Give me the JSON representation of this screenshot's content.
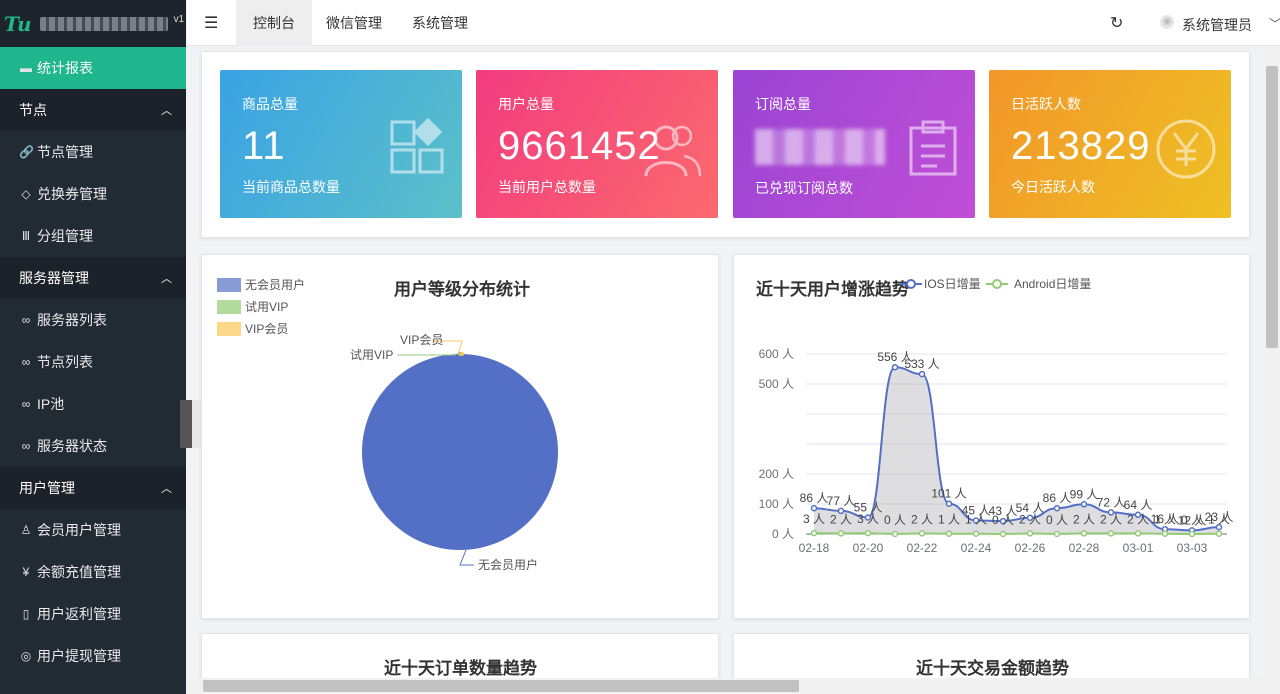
{
  "brand": {
    "logo": "Tu",
    "version": "v1"
  },
  "sidebar": {
    "active_item": {
      "icon": "▬",
      "label": "统计报表"
    },
    "groups": [
      {
        "label": "节点",
        "items": [
          {
            "icon": "🔗",
            "label": "节点管理"
          },
          {
            "icon": "◇",
            "label": "兑换券管理"
          },
          {
            "icon": "Ⅲ",
            "label": "分组管理"
          }
        ]
      },
      {
        "label": "服务器管理",
        "items": [
          {
            "icon": "∞",
            "label": "服务器列表"
          },
          {
            "icon": "∞",
            "label": "节点列表"
          },
          {
            "icon": "∞",
            "label": "IP池"
          },
          {
            "icon": "∞",
            "label": "服务器状态"
          }
        ]
      },
      {
        "label": "用户管理",
        "items": [
          {
            "icon": "♙",
            "label": "会员用户管理"
          },
          {
            "icon": "¥",
            "label": "余额充值管理"
          },
          {
            "icon": "▯",
            "label": "用户返利管理"
          },
          {
            "icon": "◎",
            "label": "用户提现管理"
          }
        ]
      }
    ]
  },
  "topbar": {
    "tabs": [
      "控制台",
      "微信管理",
      "系统管理"
    ],
    "user_name": "系统管理员"
  },
  "stats": [
    {
      "title": "商品总量",
      "value": "11",
      "sub": "当前商品总数量",
      "icon": "grid-icon",
      "color_from": "#3aa3e3",
      "color_to": "#5cc0c9"
    },
    {
      "title": "用户总量",
      "value": "9661452",
      "sub": "当前用户总数量",
      "icon": "users-icon",
      "color_from": "#f23c7f",
      "color_to": "#fb6a6e"
    },
    {
      "title": "订阅总量",
      "value": "",
      "sub": "已兑现订阅总数",
      "icon": "clipboard-icon",
      "color_from": "#9a44d3",
      "color_to": "#c04fd6"
    },
    {
      "title": "日活跃人数",
      "value": "213829",
      "sub": "今日活跃人数",
      "icon": "yen-icon",
      "color_from": "#f2962a",
      "color_to": "#eec124"
    }
  ],
  "pie_panel": {
    "title": "用户等级分布统计",
    "legend": [
      {
        "label": "无会员用户",
        "color": "#5470c6"
      },
      {
        "label": "试用VIP",
        "color": "#91cc75"
      },
      {
        "label": "VIP会员",
        "color": "#fac858"
      }
    ],
    "callouts": {
      "vip": "VIP会员",
      "trial": "试用VIP",
      "free": "无会员用户"
    }
  },
  "line_panel": {
    "title": "近十天用户增涨趋势",
    "legend": [
      {
        "label": "IOS日增量",
        "color": "#5470c6"
      },
      {
        "label": "Android日增量",
        "color": "#91cc75"
      }
    ]
  },
  "bottom_panels": {
    "left_title": "近十天订单数量趋势",
    "right_title": "近十天交易金额趋势"
  },
  "chart_data": [
    {
      "type": "pie",
      "title": "用户等级分布统计",
      "labels": [
        "无会员用户",
        "试用VIP",
        "VIP会员"
      ],
      "values": [
        99.9,
        0.05,
        0.05
      ],
      "legend": "top-left"
    },
    {
      "type": "line",
      "title": "近十天用户增涨趋势",
      "x": [
        "02-18",
        "02-19",
        "02-20",
        "02-21",
        "02-22",
        "02-23",
        "02-24",
        "02-25",
        "02-26",
        "02-27",
        "02-28",
        "02-29",
        "03-01",
        "03-02",
        "03-03",
        "03-04"
      ],
      "x_tick_labels": [
        "02-18",
        "02-20",
        "02-22",
        "02-24",
        "02-26",
        "02-28",
        "03-01",
        "03-03"
      ],
      "y_tick_labels": [
        "0 人",
        "100 人",
        "200 人",
        "500 人",
        "600 人"
      ],
      "series": [
        {
          "name": "IOS日增量",
          "values": [
            86,
            77,
            55,
            556,
            533,
            101,
            45,
            43,
            54,
            86,
            99,
            72,
            64,
            16,
            12,
            23
          ]
        },
        {
          "name": "Android日增量",
          "values": [
            3,
            2,
            3,
            0,
            2,
            1,
            1,
            0,
            2,
            0,
            2,
            2,
            2,
            1,
            0,
            1
          ]
        }
      ],
      "value_label_suffix": " 人",
      "ylim": [
        0,
        600
      ],
      "grid": true,
      "legend": "top"
    }
  ]
}
